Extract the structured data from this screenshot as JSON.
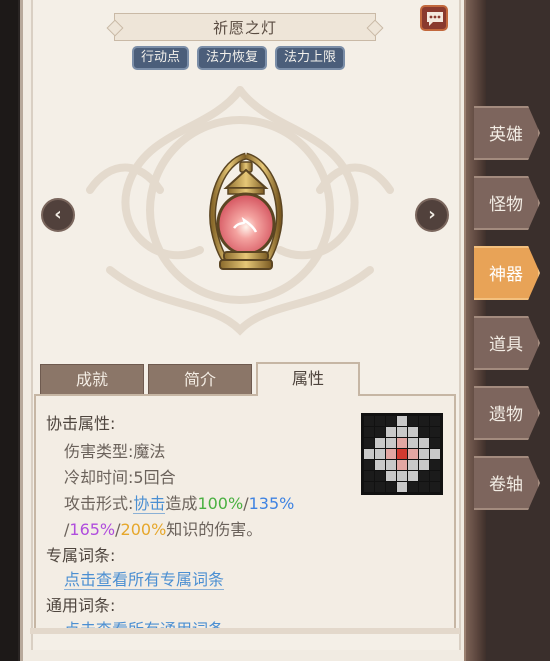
{
  "title": "祈愿之灯",
  "chips": [
    "行动点",
    "法力恢复",
    "法力上限"
  ],
  "nav": {
    "prev": "‹",
    "next": "›"
  },
  "tabs": [
    {
      "label": "成就",
      "active": false
    },
    {
      "label": "简介",
      "active": false
    },
    {
      "label": "属性",
      "active": true
    }
  ],
  "attributes": {
    "heading": "协击属性:",
    "damage_type_label": "伤害类型:",
    "damage_type_value": "魔法",
    "cooldown_label": "冷却时间:",
    "cooldown_value": "5回合",
    "attack_form_label": "攻击形式:",
    "attack_link": "协击",
    "attack_mid": "造成",
    "pct1": "100%",
    "pct2": "135%",
    "pct3": "165%",
    "pct4": "200%",
    "sep": "/",
    "attack_tail": "知识的伤害。",
    "exclusive_heading": "专属词条:",
    "exclusive_link": "点击查看所有专属词条",
    "general_heading": "通用词条:",
    "general_link": "点击查看所有通用词条"
  },
  "side_tabs": [
    {
      "label": "英雄",
      "active": false
    },
    {
      "label": "怪物",
      "active": false
    },
    {
      "label": "神器",
      "active": true
    },
    {
      "label": "道具",
      "active": false
    },
    {
      "label": "遗物",
      "active": false
    },
    {
      "label": "卷轴",
      "active": false
    }
  ],
  "colors": {
    "green": "#4ab041",
    "blue": "#3f83e2",
    "purple": "#b04ddd",
    "orange": "#e6a72b",
    "active_side_tab": "#e8a357",
    "chip": "#4b5e7a"
  },
  "icons": [
    "chat-icon",
    "lantern-icon",
    "attack-range-grid-icon"
  ]
}
